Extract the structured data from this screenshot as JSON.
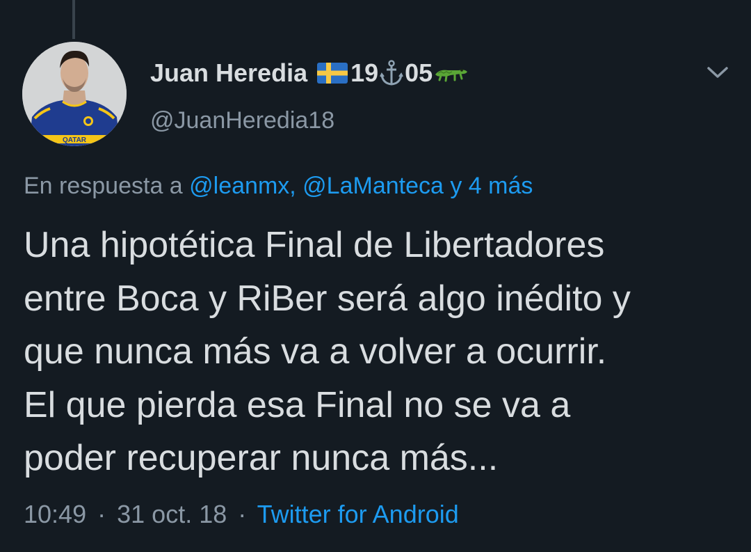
{
  "tweet": {
    "author": {
      "display_name": "Juan Heredia",
      "name_number_1": "19",
      "name_number_2": "05",
      "name_emoji": [
        "sweden-flag-icon",
        "anchor-icon",
        "crocodile-icon"
      ],
      "handle": "@JuanHeredia18",
      "avatar_text": "QATAR"
    },
    "reply_to": {
      "prefix": "En respuesta a",
      "users": "@leanmx, @LaManteca",
      "more": "y 4 más"
    },
    "text_lines": [
      "Una hipotética Final de Libertadores",
      "entre Boca y RiBer será algo inédito y",
      "que nunca más va a volver a ocurrir.",
      "El que pierda esa Final no se va a",
      "poder recuperar nunca más..."
    ],
    "meta": {
      "time": "10:49",
      "separator": "·",
      "date": "31 oct. 18",
      "source": "Twitter for Android"
    }
  },
  "colors": {
    "background": "#141b22",
    "text": "#d9dde0",
    "secondary": "#8b98a5",
    "link": "#1d9bf0",
    "jersey": "#1f3c8f",
    "jersey_stripe": "#f5c518"
  }
}
